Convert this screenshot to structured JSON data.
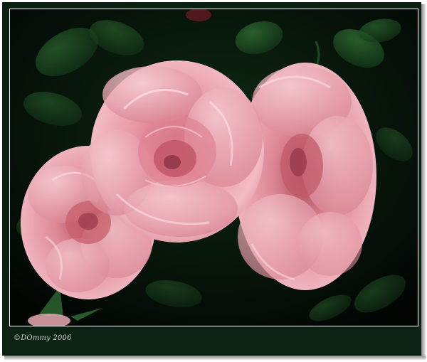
{
  "photo": {
    "description_alt": "three-pink-roses-photo",
    "colors": {
      "mat": "#0a2114",
      "background": "#040a05",
      "leaf": "#1f4a24",
      "rose_light": "#f2b8c0",
      "rose_mid": "#e08f9c",
      "rose_dark": "#b85a6c"
    }
  },
  "caption": {
    "copyright": "©DOmmy 2006"
  }
}
